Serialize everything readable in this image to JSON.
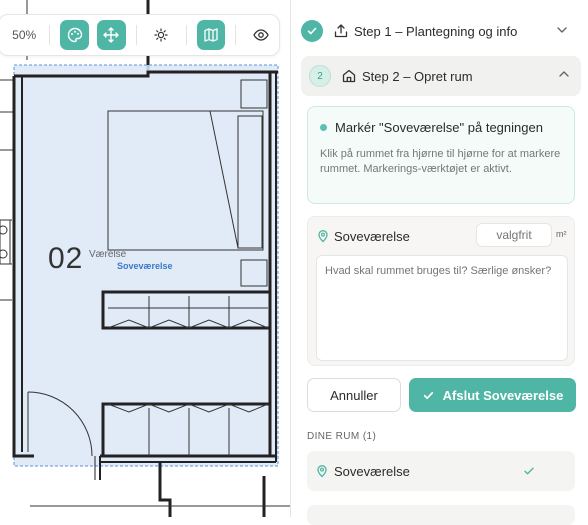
{
  "toolbar": {
    "zoom": "50%",
    "tools": [
      {
        "icon": "palette-icon",
        "active": true
      },
      {
        "icon": "move-icon",
        "active": true
      },
      {
        "icon": "sun-icon",
        "active": false
      },
      {
        "icon": "map-icon",
        "active": true
      },
      {
        "icon": "eye-icon",
        "active": false
      }
    ],
    "accent": "#4fb6a5"
  },
  "canvas": {
    "room_number": "02",
    "room_type": "Værelse",
    "room_name": "Soveværelse",
    "room_fill": "#dce8f6",
    "room_border": "#5a93d8"
  },
  "panel": {
    "step1": {
      "label": "Step 1 – Plantegning og info",
      "icon": "upload-icon",
      "done": true
    },
    "step2": {
      "number": "2",
      "label": "Step 2 – Opret rum",
      "icon": "house-icon",
      "expanded": true
    },
    "instruction": {
      "title": "Markér \"Soveværelse\" på tegningen",
      "body": "Klik på rummet fra hjørne til hjørne for at markere rummet. Markerings-værktøjet er aktivt."
    },
    "room_form": {
      "name": "Soveværelse",
      "area_placeholder": "valgfrit",
      "area_unit": "m²",
      "description_placeholder": "Hvad skal rummet bruges til? Særlige ønsker?"
    },
    "buttons": {
      "cancel": "Annuller",
      "finish": "Afslut Soveværelse"
    },
    "your_rooms": {
      "heading": "DINE RUM (1)",
      "items": [
        {
          "name": "Soveværelse",
          "done": true
        }
      ]
    }
  }
}
